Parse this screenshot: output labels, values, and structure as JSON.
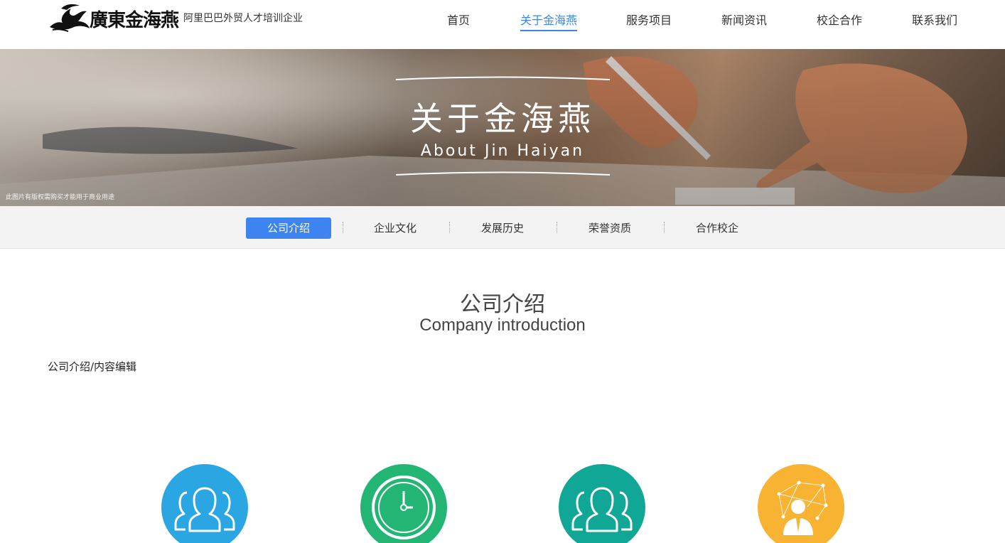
{
  "header": {
    "logo_text": "廣東金海燕",
    "tagline": "阿里巴巴外贸人才培训企业",
    "nav": [
      {
        "label": "首页",
        "active": false
      },
      {
        "label": "关于金海燕",
        "active": true
      },
      {
        "label": "服务项目",
        "active": false
      },
      {
        "label": "新闻资讯",
        "active": false
      },
      {
        "label": "校企合作",
        "active": false
      },
      {
        "label": "联系我们",
        "active": false
      }
    ],
    "accent_color": "#3a86e8"
  },
  "banner": {
    "title": "关于金海燕",
    "subtitle": "About Jin Haiyan",
    "note": "此图片有版权需购买才能用于商业用途"
  },
  "subnav": {
    "items": [
      {
        "label": "公司介绍",
        "active": true
      },
      {
        "label": "企业文化",
        "active": false
      },
      {
        "label": "发展历史",
        "active": false
      },
      {
        "label": "荣誉资质",
        "active": false
      },
      {
        "label": "合作校企",
        "active": false
      }
    ],
    "active_color": "#3d84f0"
  },
  "section": {
    "title": "公司介绍",
    "subtitle": "Company introduction",
    "content": "公司介绍/内容编辑"
  },
  "features": [
    {
      "icon": "group-icon",
      "color": "#2aa6e3"
    },
    {
      "icon": "clock-icon",
      "color": "#22b573"
    },
    {
      "icon": "group-icon",
      "color": "#11a796"
    },
    {
      "icon": "businessman-network-icon",
      "color": "#f8b333"
    }
  ]
}
